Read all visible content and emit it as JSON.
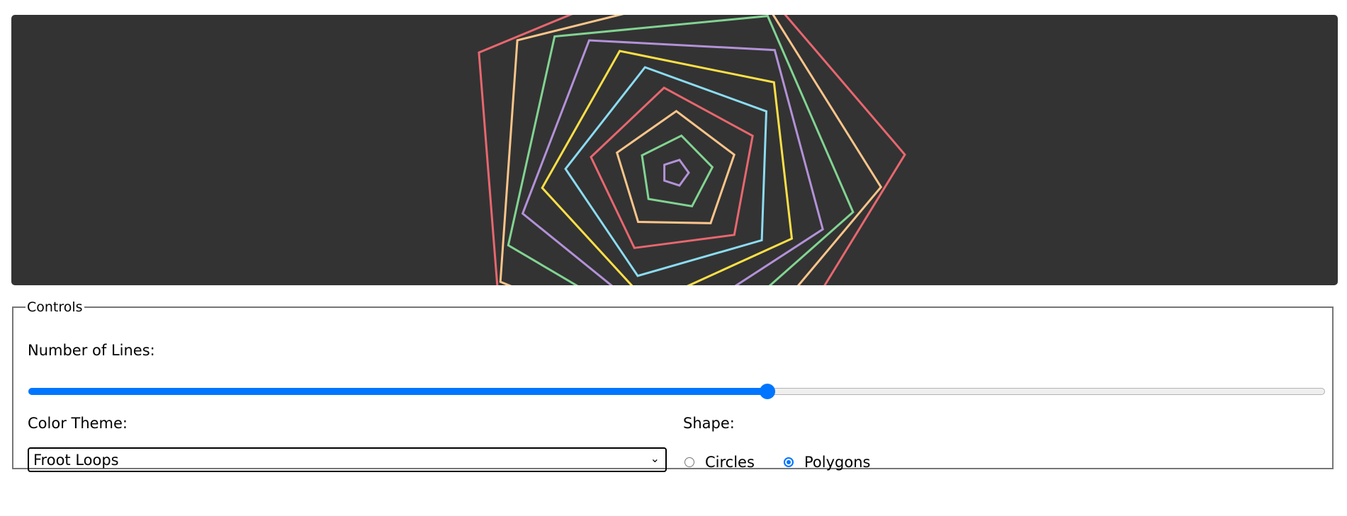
{
  "canvas": {
    "background": "#333333",
    "shape": "polygon",
    "sides": 5,
    "shapes_drawn": 10,
    "palette": [
      "#b392d8",
      "#82d492",
      "#fcc58a",
      "#e8676f",
      "#8cdcf2",
      "#fde047"
    ]
  },
  "controls": {
    "legend": "Controls",
    "lines_label": "Number of Lines:",
    "lines_slider_fraction": 0.57,
    "theme_label": "Color Theme:",
    "theme_selected": "Froot Loops",
    "shape_label": "Shape:",
    "shape_options": [
      {
        "label": "Circles",
        "checked": false
      },
      {
        "label": "Polygons",
        "checked": true
      }
    ]
  },
  "accent": "#0075ff"
}
